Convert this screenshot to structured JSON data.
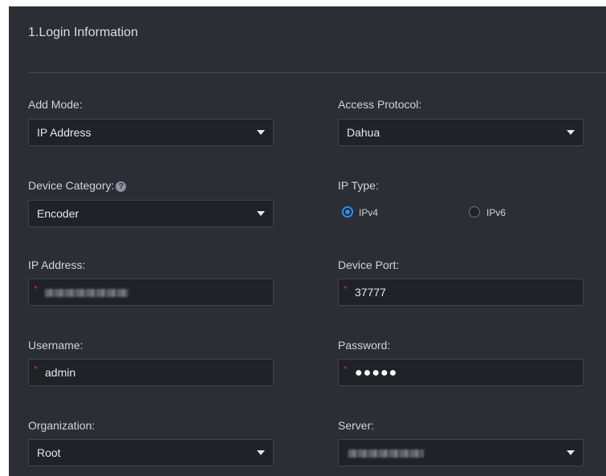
{
  "section": {
    "title": "1.Login Information"
  },
  "add_mode": {
    "label": "Add Mode:",
    "value": "IP Address"
  },
  "access_protocol": {
    "label": "Access Protocol:",
    "value": "Dahua"
  },
  "device_category": {
    "label": "Device Category:",
    "value": "Encoder"
  },
  "ip_type": {
    "label": "IP Type:",
    "options": [
      "IPv4",
      "IPv6"
    ],
    "selected": "IPv4"
  },
  "ip_address": {
    "label": "IP Address:"
  },
  "device_port": {
    "label": "Device Port:",
    "value": "37777"
  },
  "username": {
    "label": "Username:",
    "value": "admin"
  },
  "password": {
    "label": "Password:",
    "masked": "●●●●●"
  },
  "organization": {
    "label": "Organization:",
    "value": "Root"
  },
  "server": {
    "label": "Server:"
  },
  "required_mark": "*",
  "help_glyph": "?",
  "colors": {
    "accent": "#2e8ff2",
    "required": "#e02424",
    "panel": "#2b2f35",
    "field": "#1f2227"
  }
}
